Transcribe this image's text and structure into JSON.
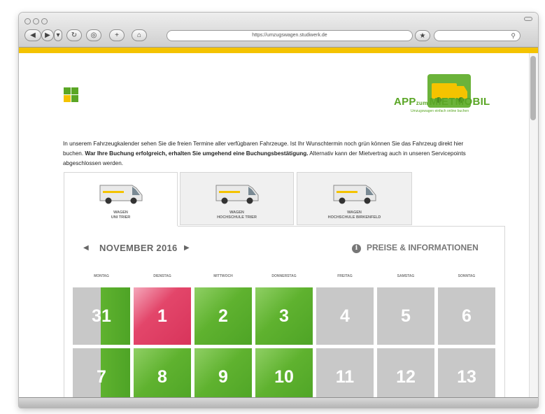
{
  "browser": {
    "url": "https://umzugswagen.studiwerk.de"
  },
  "brand": {
    "main": "APP",
    "small": "zum",
    "rest": "MIETMOBIL",
    "tagline": "Umzugswagen einfach online buchen",
    "accent_green": "#5aa625",
    "accent_yellow": "#f4c300"
  },
  "intro": {
    "text1": "In unserem Fahrzeugkalender sehen Sie die freien Termine aller verfügbaren Fahrzeuge. Ist Ihr Wunschtermin noch grün können Sie das Fahrzeug direkt hier buchen. ",
    "bold": "War Ihre Buchung erfolgreich, erhalten Sie umgehend eine Buchungs­bestätigung.",
    "text2": " Alternativ kann der Mietvertrag auch in unseren Servicepoints abgeschlossen werden."
  },
  "tabs": [
    {
      "line1": "WAGEN",
      "line2": "UNI TRIER"
    },
    {
      "line1": "WAGEN",
      "line2": "HOCHSCHULE TRIER"
    },
    {
      "line1": "WAGEN",
      "line2": "HOCHSCHULE BIRKENFELD"
    }
  ],
  "calendar": {
    "month": "NOVEMBER 2016",
    "info": "PREISE & INFORMATIONEN",
    "info_icon": "i",
    "days": [
      "MONTAG",
      "DIENSTAG",
      "MITTWOCH",
      "DONNERSTAG",
      "FREITAG",
      "SAMSTAG",
      "SONNTAG"
    ],
    "row1": [
      "31",
      "1",
      "2",
      "3",
      "4",
      "5",
      "6"
    ],
    "row2": [
      "7",
      "8",
      "9",
      "10",
      "11",
      "12",
      "13"
    ]
  }
}
